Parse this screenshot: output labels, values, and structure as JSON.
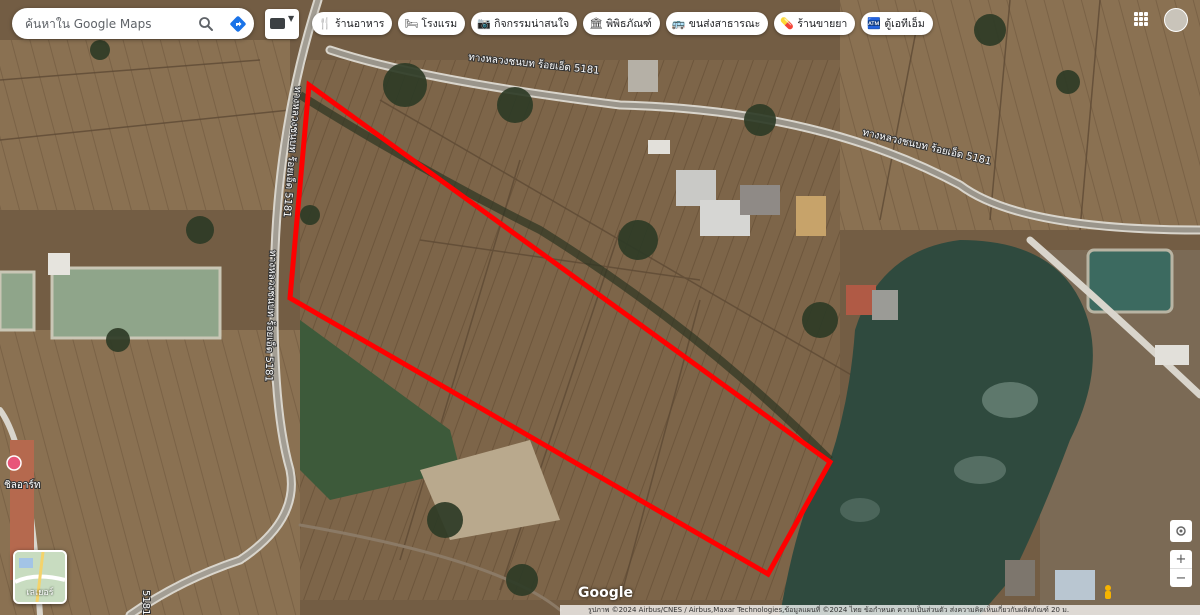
{
  "search": {
    "placeholder": "ค้นหาใน Google Maps"
  },
  "chips": [
    {
      "icon": "fork-knife-icon",
      "glyph": "🍴",
      "label": "ร้านอาหาร"
    },
    {
      "icon": "bed-icon",
      "glyph": "🛏",
      "label": "โรงแรม"
    },
    {
      "icon": "camera-icon",
      "glyph": "📷",
      "label": "กิจกรรมน่าสนใจ"
    },
    {
      "icon": "museum-icon",
      "glyph": "🏛",
      "label": "พิพิธภัณฑ์"
    },
    {
      "icon": "transit-icon",
      "glyph": "🚌",
      "label": "ขนส่งสาธารณะ"
    },
    {
      "icon": "pharmacy-icon",
      "glyph": "💊",
      "label": "ร้านขายยา"
    },
    {
      "icon": "atm-icon",
      "glyph": "🏧",
      "label": "ตู้เอทีเอ็ม"
    }
  ],
  "roads": {
    "top_1": "ทางหลวงชนบท ร้อยเอ็ด 5181",
    "top_2": "ทางหลวงชนบท ร้อยเอ็ด 5181",
    "left_upper": "ทางหลวงชนบท ร้อยเอ็ด 5181",
    "left_lower": "ทางหลวงชนบท ร้อยเอ็ด 5181",
    "bottom_left": "5181"
  },
  "poi": {
    "label": "ชิลอาร์ท"
  },
  "layers": {
    "label": "เลเยอร์"
  },
  "logo": "Google",
  "attribution": "รูปภาพ ©2024 Airbus/CNES / Airbus,Maxar Technologies,ข้อมูลแผนที่ ©2024   ไทย   ข้อกำหนด   ความเป็นส่วนตัว   ส่งความคิดเห็นเกี่ยวกับผลิตภัณฑ์   20 ม.",
  "colors": {
    "boundary": "#ff0000",
    "water": "#2f4a3e",
    "field": "#7a6247"
  }
}
